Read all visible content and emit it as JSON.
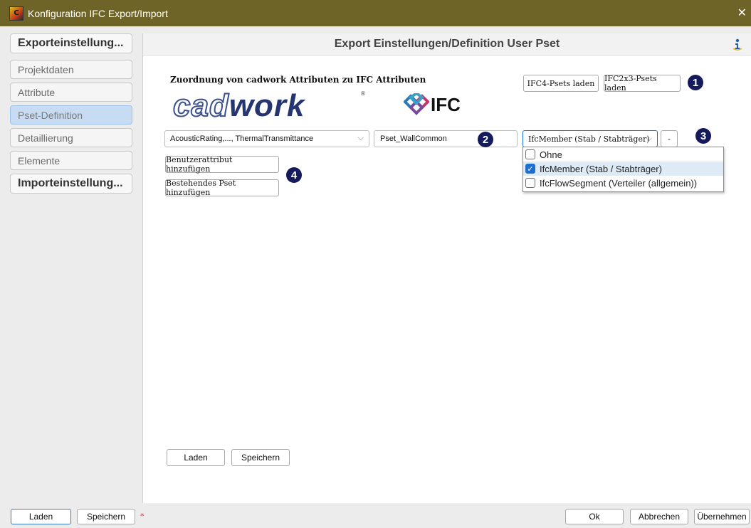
{
  "window": {
    "title": "Konfiguration IFC Export/Import",
    "icon_text": "C",
    "close_glyph": "✕"
  },
  "sidebar": {
    "export_label": "Exporteinstellung...",
    "items": [
      "Projektdaten",
      "Attribute",
      "Pset-Definition",
      "Detaillierung",
      "Elemente"
    ],
    "active_index": 2,
    "import_label": "Importeinstellung..."
  },
  "main": {
    "header": "Export Einstellungen/Definition User Pset",
    "assign_label": "Zuordnung von cadwork Attributen zu IFC Attributen",
    "logo_cadwork": {
      "cad": "cad",
      "work": "work",
      "reg": "®"
    },
    "logo_ifc": "IFC",
    "load_ifc4": "IFC4-Psets laden",
    "load_ifc2x3": "IFC2x3-Psets laden",
    "attributes_combo": "AcousticRating,..., ThermalTransmittance",
    "pset_name": "Pset_WallCommon",
    "entity_combo": "IfcMember (Stab / Stabträger)",
    "minus_label": "-",
    "add_user_attr": "Benutzerattribut hinzufügen",
    "add_existing_pset": "Bestehendes Pset hinzufügen",
    "dropdown_items": [
      {
        "label": "Ohne",
        "checked": false
      },
      {
        "label": "IfcMember (Stab / Stabträger)",
        "checked": true
      },
      {
        "label": "IfcFlowSegment (Verteiler (allgemein))",
        "checked": false
      }
    ],
    "bottom_load": "Laden",
    "bottom_save": "Speichern"
  },
  "markers": [
    "1",
    "2",
    "3",
    "4"
  ],
  "footer": {
    "load": "Laden",
    "save": "Speichern",
    "unsaved_mark": "*",
    "ok": "Ok",
    "cancel": "Abbrechen",
    "apply": "Übernehmen"
  },
  "colors": {
    "titlebar": "#6e6427",
    "marker": "#141a5c",
    "active_side": "#c7dcf3",
    "cadwork": "#24356f"
  }
}
